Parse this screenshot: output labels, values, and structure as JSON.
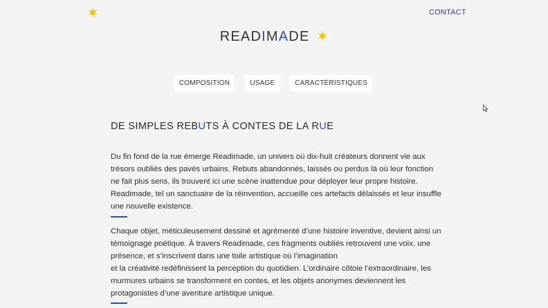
{
  "header": {
    "star_icon": "star-icon",
    "contact_label": "CONTACT"
  },
  "logo": {
    "part1": "READ",
    "part2": "I",
    "part3": "M",
    "part4": "A",
    "part5": "DE",
    "star_icon": "star-icon"
  },
  "tabs": [
    {
      "label": "COMPOSITION"
    },
    {
      "label": "USAGE"
    },
    {
      "label": "CARACTÉRISTIQUES"
    }
  ],
  "section": {
    "title_part1": "DE SIMPLES REB",
    "title_part2": "U",
    "title_part3": "TS À CONTES DE LA R",
    "title_part4": "U",
    "title_part5": "E"
  },
  "paragraphs": {
    "p1": "Du fin fond de la rue émerge Readimade, un univers où dix-huit créateurs donnent vie aux trésors oubliés des pavés urbains. Rebuts abandonnés, laissés ou perdus là où leur fonction ne fait plus sens, ils trouvent ici une scène inattendue pour déployer leur propre histoire. Readimade, tel un sanctuaire de la réinvention, accueille ces artefacts délaissés et leur insuffle une nouvelle existence.",
    "p2_line1": "Chaque objet, méticuleusement dessiné et agrémenté d’une histoire inventive, devient ainsi un témoignage poétique. À travers Readimade, ces fragments oubliés retrouvent une voix, une présence, et s’inscrivent dans une toile artistique où l’imagination",
    "p2_line2": "et la créativité redéfinissent la perception du quotidien. L’ordinaire côtoie l’extraordinaire, les murmures urbains se transforment en contes, et les objets anonymes deviennent les protagonistes d’une aventure artistique unique."
  },
  "colors": {
    "accent": "#2e4fa3",
    "star": "#f2c200",
    "background": "#f4f4f4"
  }
}
